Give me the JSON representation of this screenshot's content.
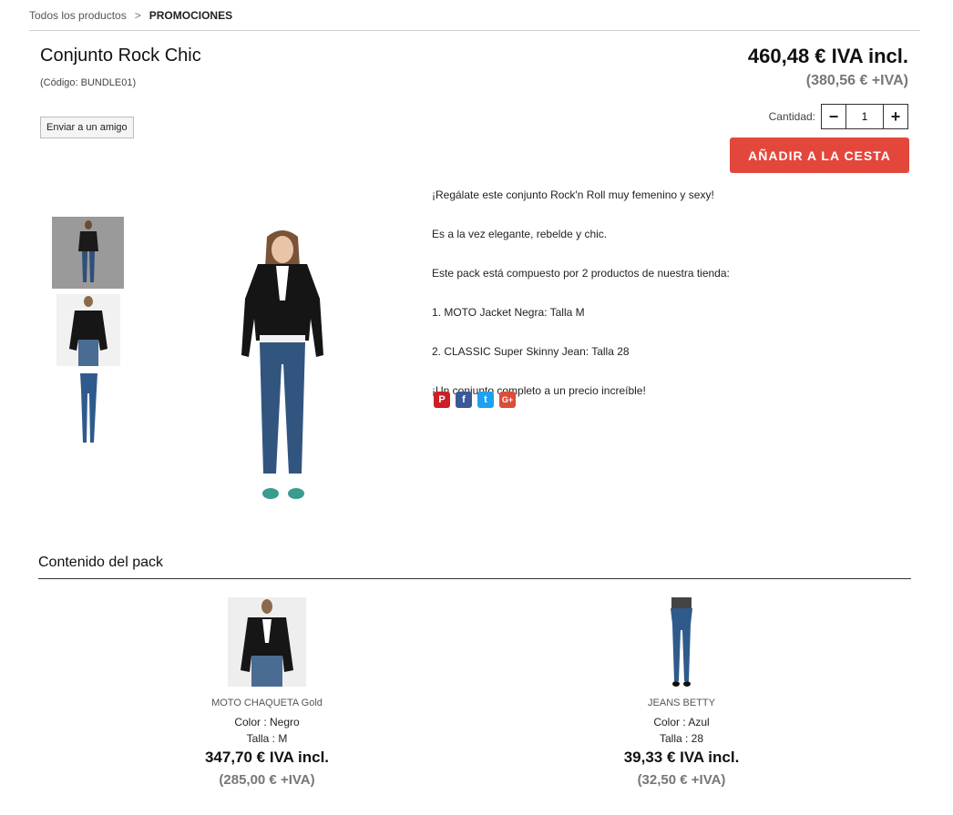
{
  "breadcrumb": {
    "root": "Todos los productos",
    "separator": ">",
    "current": "PROMOCIONES"
  },
  "product": {
    "title": "Conjunto Rock Chic",
    "code": "(Código: BUNDLE01)",
    "send_friend_label": "Enviar a un amigo",
    "price_incl": "460,48 € IVA incl.",
    "price_excl": "(380,56 € +IVA)",
    "quantity_label": "Cantidad:",
    "quantity_value": "1",
    "decrement_symbol": "−",
    "increment_symbol": "+",
    "add_to_cart_label": "AÑADIR A LA CESTA",
    "description": [
      "¡Regálate este conjunto Rock'n Roll muy femenino y sexy!",
      "Es a la vez elegante, rebelde y chic.",
      "Este pack está compuesto por 2 productos de nuestra tienda:",
      "1. MOTO Jacket Negra: Talla M",
      "2. CLASSIC Super Skinny Jean: Talla 28",
      "¡Un conjunto completo a un precio increíble!"
    ],
    "social": [
      {
        "icon": "pinterest-icon",
        "glyph": "P",
        "color": "#cb2027"
      },
      {
        "icon": "facebook-icon",
        "glyph": "f",
        "color": "#3b5998"
      },
      {
        "icon": "twitter-icon",
        "glyph": "t",
        "color": "#1da1f2"
      },
      {
        "icon": "google-plus-icon",
        "glyph": "G+",
        "color": "#dd4b39"
      }
    ]
  },
  "pack": {
    "title": "Contenido del pack",
    "items": [
      {
        "name": "MOTO CHAQUETA Gold",
        "color": "Color : Negro",
        "size": "Talla : M",
        "price_incl": "347,70 € IVA incl.",
        "price_excl": "(285,00 € +IVA)"
      },
      {
        "name": "JEANS BETTY",
        "color": "Color : Azul",
        "size": "Talla : 28",
        "price_incl": "39,33 € IVA incl.",
        "price_excl": "(32,50 € +IVA)"
      }
    ]
  },
  "colors": {
    "accent": "#e3473c",
    "muted_price": "#777777"
  }
}
